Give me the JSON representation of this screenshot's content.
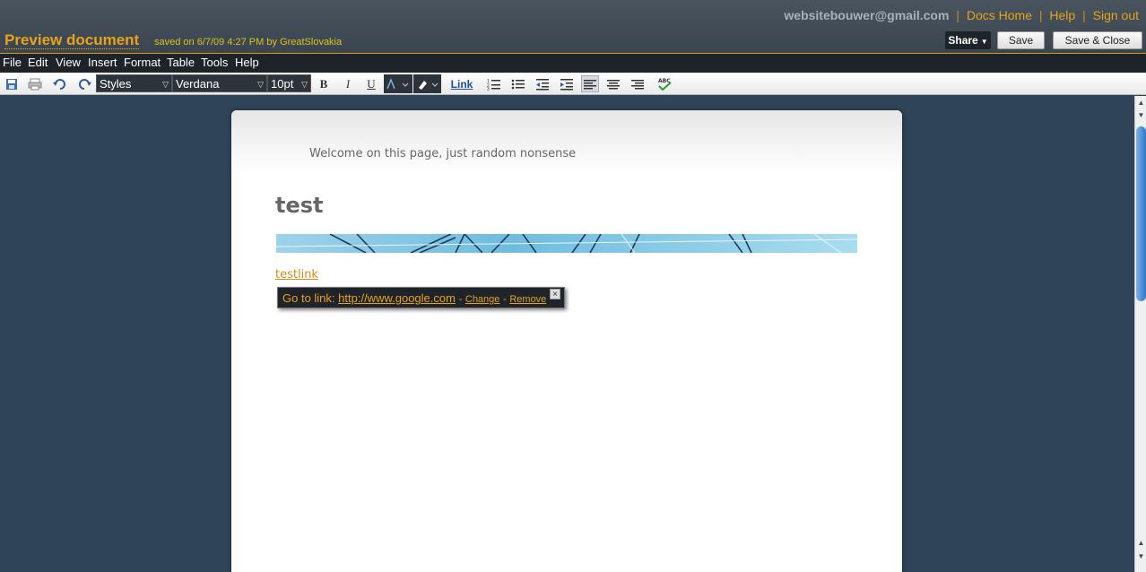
{
  "account": {
    "email": "websitebouwer@gmail.com",
    "docs_home": "Docs Home",
    "help": "Help",
    "sign_out": "Sign out",
    "separator": "|"
  },
  "document": {
    "title": "Preview document",
    "save_status": "saved on 6/7/09 4:27 PM by GreatSlovakia"
  },
  "header_buttons": {
    "share": "Share",
    "save": "Save",
    "save_close": "Save & Close"
  },
  "menu": [
    "File",
    "Edit",
    "View",
    "Insert",
    "Format",
    "Table",
    "Tools",
    "Help"
  ],
  "toolbar": {
    "style": "Styles",
    "font": "Verdana",
    "size": "10pt",
    "bold": "B",
    "italic": "I",
    "underline": "U",
    "link": "Link"
  },
  "page": {
    "welcome": "Welcome on this page, just random nonsense",
    "heading": "test",
    "link_text": "testlink"
  },
  "link_bubble": {
    "go_to": "Go to link:",
    "url": "http://www.google.com",
    "dash": "-",
    "change": "Change",
    "remove": "Remove"
  },
  "colors": {
    "accent": "#e8a21b",
    "page_background": "#2f4459"
  }
}
